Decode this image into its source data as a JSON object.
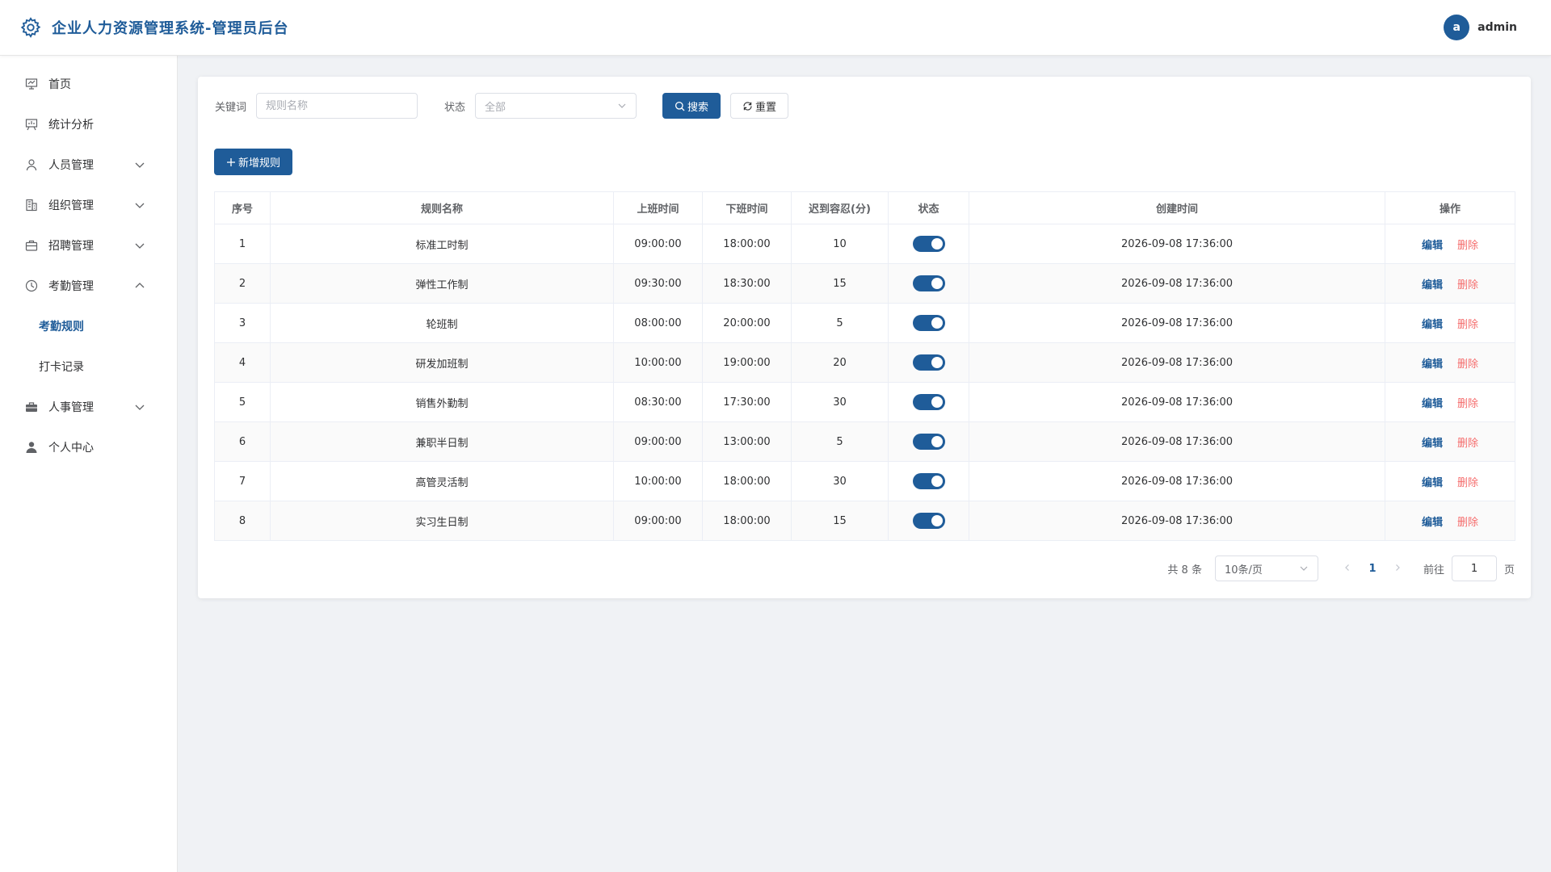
{
  "header": {
    "title": "企业人力资源管理系统-管理员后台",
    "avatar_letter": "a",
    "username": "admin"
  },
  "sidebar": {
    "items": [
      {
        "label": "首页",
        "icon": "presentation-icon"
      },
      {
        "label": "统计分析",
        "icon": "chart-board-icon"
      },
      {
        "label": "人员管理",
        "icon": "user-icon",
        "expandable": true
      },
      {
        "label": "组织管理",
        "icon": "building-icon",
        "expandable": true
      },
      {
        "label": "招聘管理",
        "icon": "briefcase-icon",
        "expandable": true
      },
      {
        "label": "考勤管理",
        "icon": "clock-icon",
        "expandable": true,
        "expanded": true,
        "children": [
          {
            "label": "考勤规则",
            "active": true
          },
          {
            "label": "打卡记录"
          }
        ]
      },
      {
        "label": "人事管理",
        "icon": "suitcase-icon",
        "expandable": true
      },
      {
        "label": "个人中心",
        "icon": "person-icon"
      }
    ]
  },
  "filter": {
    "keyword_label": "关键词",
    "keyword_placeholder": "规则名称",
    "status_label": "状态",
    "status_value": "全部",
    "search_label": "搜索",
    "reset_label": "重置"
  },
  "add_button_label": "新增规则",
  "table": {
    "columns": [
      "序号",
      "规则名称",
      "上班时间",
      "下班时间",
      "迟到容忍(分)",
      "状态",
      "创建时间",
      "操作"
    ],
    "rows": [
      {
        "idx": "1",
        "name": "标准工时制",
        "start": "09:00:00",
        "end": "18:00:00",
        "late": "10",
        "enabled": true,
        "created": "2026-09-08 17:36:00"
      },
      {
        "idx": "2",
        "name": "弹性工作制",
        "start": "09:30:00",
        "end": "18:30:00",
        "late": "15",
        "enabled": true,
        "created": "2026-09-08 17:36:00"
      },
      {
        "idx": "3",
        "name": "轮班制",
        "start": "08:00:00",
        "end": "20:00:00",
        "late": "5",
        "enabled": true,
        "created": "2026-09-08 17:36:00"
      },
      {
        "idx": "4",
        "name": "研发加班制",
        "start": "10:00:00",
        "end": "19:00:00",
        "late": "20",
        "enabled": true,
        "created": "2026-09-08 17:36:00"
      },
      {
        "idx": "5",
        "name": "销售外勤制",
        "start": "08:30:00",
        "end": "17:30:00",
        "late": "30",
        "enabled": true,
        "created": "2026-09-08 17:36:00"
      },
      {
        "idx": "6",
        "name": "兼职半日制",
        "start": "09:00:00",
        "end": "13:00:00",
        "late": "5",
        "enabled": true,
        "created": "2026-09-08 17:36:00"
      },
      {
        "idx": "7",
        "name": "高管灵活制",
        "start": "10:00:00",
        "end": "18:00:00",
        "late": "30",
        "enabled": true,
        "created": "2026-09-08 17:36:00"
      },
      {
        "idx": "8",
        "name": "实习生日制",
        "start": "09:00:00",
        "end": "18:00:00",
        "late": "15",
        "enabled": true,
        "created": "2026-09-08 17:36:00"
      }
    ],
    "edit_label": "编辑",
    "delete_label": "删除"
  },
  "pagination": {
    "total_text": "共 8 条",
    "page_size": "10条/页",
    "current_page": "1",
    "goto_label": "前往",
    "goto_value": "1",
    "page_suffix": "页"
  },
  "colors": {
    "primary": "#1f5c99",
    "danger": "#f56c6c"
  }
}
